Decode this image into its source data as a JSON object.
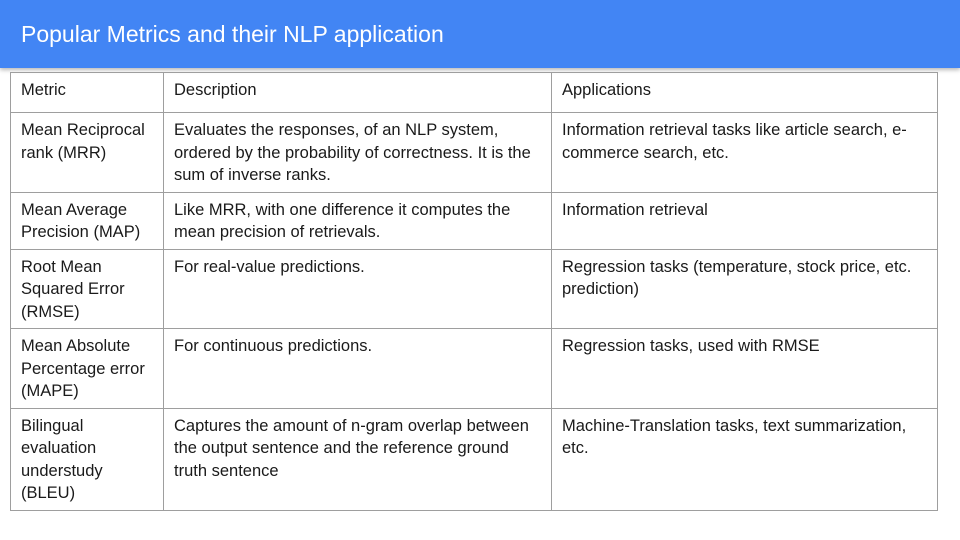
{
  "slide": {
    "title": "Popular Metrics and their NLP application"
  },
  "table": {
    "headers": {
      "metric": "Metric",
      "description": "Description",
      "applications": "Applications"
    },
    "rows": [
      {
        "metric": "Mean Reciprocal rank (MRR)",
        "description": "Evaluates the responses, of an NLP system, ordered by the probability of correctness. It is the sum of inverse ranks.",
        "applications": "Information retrieval tasks like article search, e-commerce search, etc."
      },
      {
        "metric": "Mean Average Precision (MAP)",
        "description": "Like MRR, with one difference it computes the mean precision of retrievals.",
        "applications": "Information retrieval"
      },
      {
        "metric": "Root Mean Squared Error (RMSE)",
        "description": "For real-value predictions.",
        "applications": "Regression tasks (temperature, stock price, etc. prediction)"
      },
      {
        "metric": "Mean Absolute Percentage error (MAPE)",
        "description": "For continuous predictions.",
        "applications": "Regression tasks, used with RMSE"
      },
      {
        "metric": "Bilingual evaluation understudy (BLEU)",
        "description": "Captures the amount of n-gram overlap between the output sentence and the reference ground truth sentence",
        "applications": "Machine-Translation tasks, text summarization, etc."
      }
    ]
  }
}
